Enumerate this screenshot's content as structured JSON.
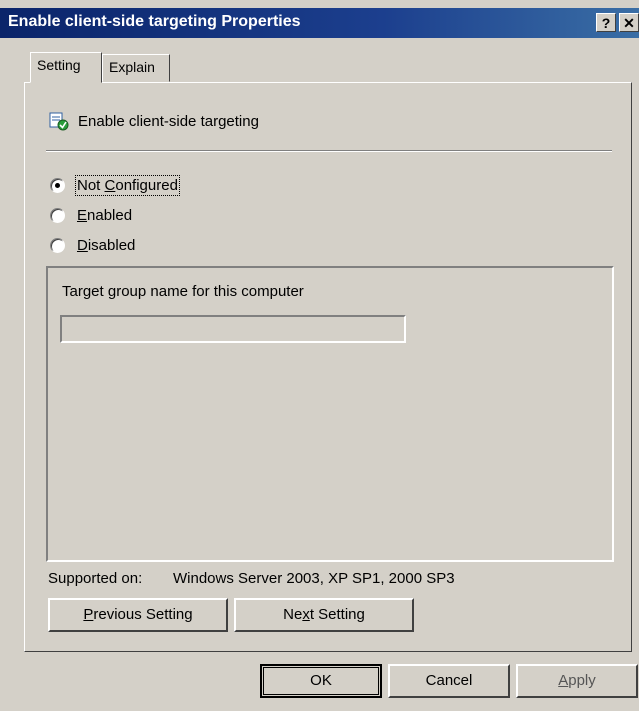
{
  "window": {
    "title": "Enable client-side targeting Properties",
    "help_glyph": "?",
    "close_glyph": "✕"
  },
  "tabs": [
    {
      "label": "Setting",
      "selected": true
    },
    {
      "label": "Explain",
      "selected": false
    }
  ],
  "policy": {
    "icon": "policy-setting-icon",
    "name": "Enable client-side targeting"
  },
  "state_options": [
    {
      "label": "Not Configured",
      "mnemonic_prefix": "Not ",
      "mnemonic": "C",
      "mnemonic_suffix": "onfigured",
      "checked": true
    },
    {
      "label": "Enabled",
      "mnemonic_prefix": "",
      "mnemonic": "E",
      "mnemonic_suffix": "nabled",
      "checked": false
    },
    {
      "label": "Disabled",
      "mnemonic_prefix": "",
      "mnemonic": "D",
      "mnemonic_suffix": "isabled",
      "checked": false
    }
  ],
  "options": {
    "target_group_label": "Target group name for this computer",
    "target_group_value": ""
  },
  "supported": {
    "label": "Supported on:",
    "value": "Windows Server 2003, XP SP1, 2000 SP3"
  },
  "nav_buttons": {
    "previous_prefix": "",
    "previous_mnemonic": "P",
    "previous_suffix": "revious Setting",
    "next_prefix": "Ne",
    "next_mnemonic": "x",
    "next_suffix": "t Setting"
  },
  "dialog_buttons": {
    "ok": "OK",
    "cancel": "Cancel",
    "apply_mnemonic": "A",
    "apply_suffix": "pply"
  }
}
